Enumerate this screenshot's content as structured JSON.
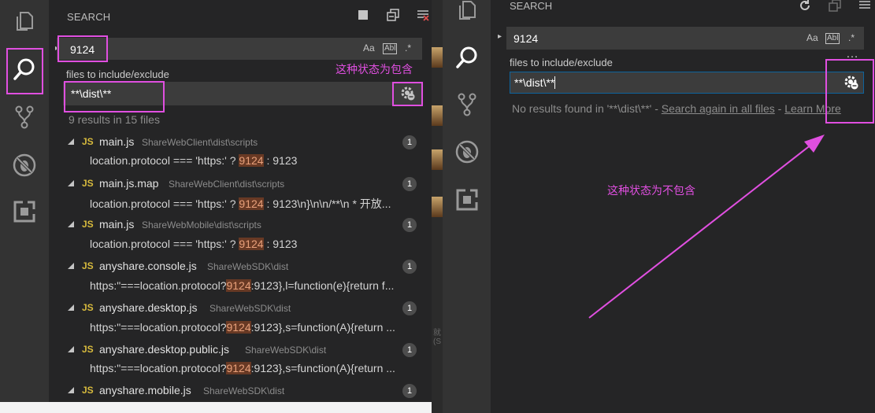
{
  "left": {
    "title": "SEARCH",
    "search_value": "9124",
    "opt_match_case": "Aa",
    "opt_whole_word": "Abl",
    "opt_regex": ".*",
    "include_label": "files to include/exclude",
    "include_value": "**\\dist\\**",
    "summary": "9 results in 15 files",
    "files": [
      {
        "name": "main.js",
        "path": "ShareWebClient\\dist\\scripts",
        "count": "1",
        "pre": "location.protocol === 'https:' ? ",
        "hit": "9124",
        "post": " : 9123"
      },
      {
        "name": "main.js.map",
        "path": "ShareWebClient\\dist\\scripts",
        "count": "1",
        "pre": "location.protocol === 'https:' ? ",
        "hit": "9124",
        "post": " : 9123\\n}\\n\\n/**\\n * 开放..."
      },
      {
        "name": "main.js",
        "path": "ShareWebMobile\\dist\\scripts",
        "count": "1",
        "pre": "location.protocol === 'https:' ? ",
        "hit": "9124",
        "post": " : 9123"
      },
      {
        "name": "anyshare.console.js",
        "path": "ShareWebSDK\\dist",
        "count": "1",
        "pre": "https:\"===location.protocol?",
        "hit": "9124",
        "post": ":9123},l=function(e){return f..."
      },
      {
        "name": "anyshare.desktop.js",
        "path": "ShareWebSDK\\dist",
        "count": "1",
        "pre": "https:\"===location.protocol?",
        "hit": "9124",
        "post": ":9123},s=function(A){return ..."
      },
      {
        "name": "anyshare.desktop.public.js",
        "path": "ShareWebSDK\\dist",
        "count": "1",
        "pre": "https:\"===location.protocol?",
        "hit": "9124",
        "post": ":9123},s=function(A){return ..."
      },
      {
        "name": "anyshare.mobile.js",
        "path": "ShareWebSDK\\dist",
        "count": "1"
      }
    ]
  },
  "right": {
    "title": "SEARCH",
    "search_value": "9124",
    "opt_match_case": "Aa",
    "opt_whole_word": "Abl",
    "opt_regex": ".*",
    "more": "…",
    "include_label": "files to include/exclude",
    "include_value": "**\\dist\\**",
    "no_results_prefix": "No results found in '**\\dist\\**' - ",
    "search_again": "Search again in all files",
    "dash": " - ",
    "learn_more": "Learn More"
  },
  "annotations": {
    "include_state": "这种状态为包含",
    "exclude_state": "这种状态为不包含"
  },
  "colors": {
    "highlight_box": "#e04fe0",
    "match_highlight": "#683924",
    "js_icon": "#d7ba3d"
  },
  "mid": {
    "fragment": "就(S"
  }
}
